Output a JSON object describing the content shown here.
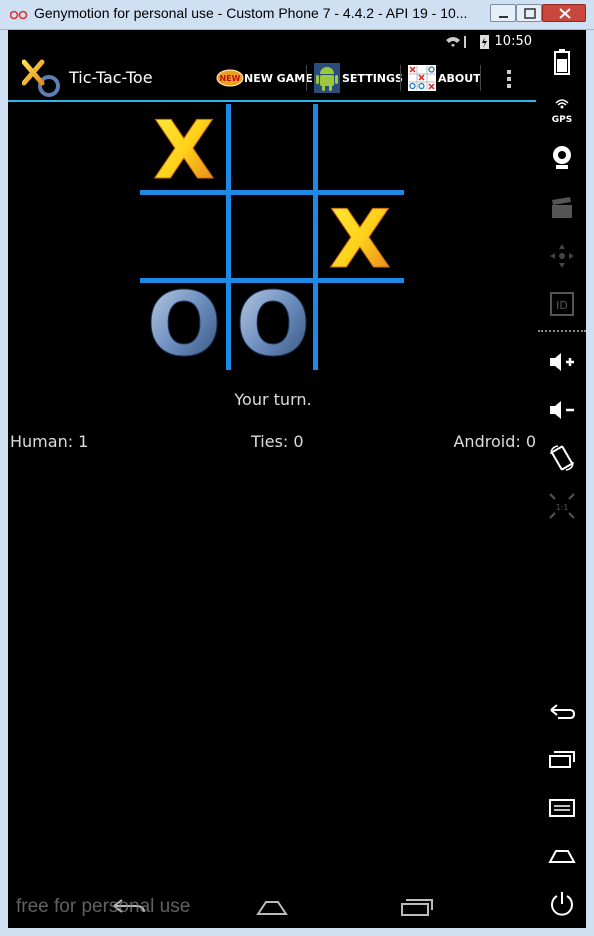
{
  "window": {
    "title": "Genymotion for personal use - Custom Phone 7 - 4.4.2 - API 19 - 10..."
  },
  "status_bar": {
    "time": "10:50"
  },
  "action_bar": {
    "app_title": "Tic-Tac-Toe",
    "menu": [
      {
        "label": "NEW GAME",
        "icon": "new-badge-icon"
      },
      {
        "label": "SETTINGS",
        "icon": "android-icon"
      },
      {
        "label": "ABOUT",
        "icon": "tictactoe-grid-icon"
      }
    ],
    "overflow_icon": "overflow-menu-icon"
  },
  "board": {
    "cells": [
      "X",
      "",
      "",
      "",
      "",
      "X",
      "O",
      "O",
      ""
    ]
  },
  "game": {
    "turn_message": "Your turn.",
    "human_score": "Human: 1",
    "ties_score": "Ties: 0",
    "android_score": "Android: 0"
  },
  "navbar": {
    "buttons": [
      "back-icon",
      "home-icon",
      "recent-apps-icon"
    ]
  },
  "watermark": "free for personal use",
  "sidebar": {
    "items": [
      "battery-icon",
      "gps-icon",
      "webcam-icon",
      "video-capture-icon",
      "dpad-icon",
      "id-icon",
      "volume-up-icon",
      "volume-down-icon",
      "rotate-icon",
      "pixel-perfect-icon",
      "back-icon",
      "recent-apps-icon",
      "menu-icon",
      "home-icon",
      "power-icon"
    ],
    "gps_label": "GPS",
    "id_label": "ID",
    "pixel_label": "1:1"
  },
  "colors": {
    "accent": "#33b5e5",
    "grid": "#1e88e5",
    "x_mark": "#f5a623",
    "o_mark": "#4a6fa5"
  }
}
